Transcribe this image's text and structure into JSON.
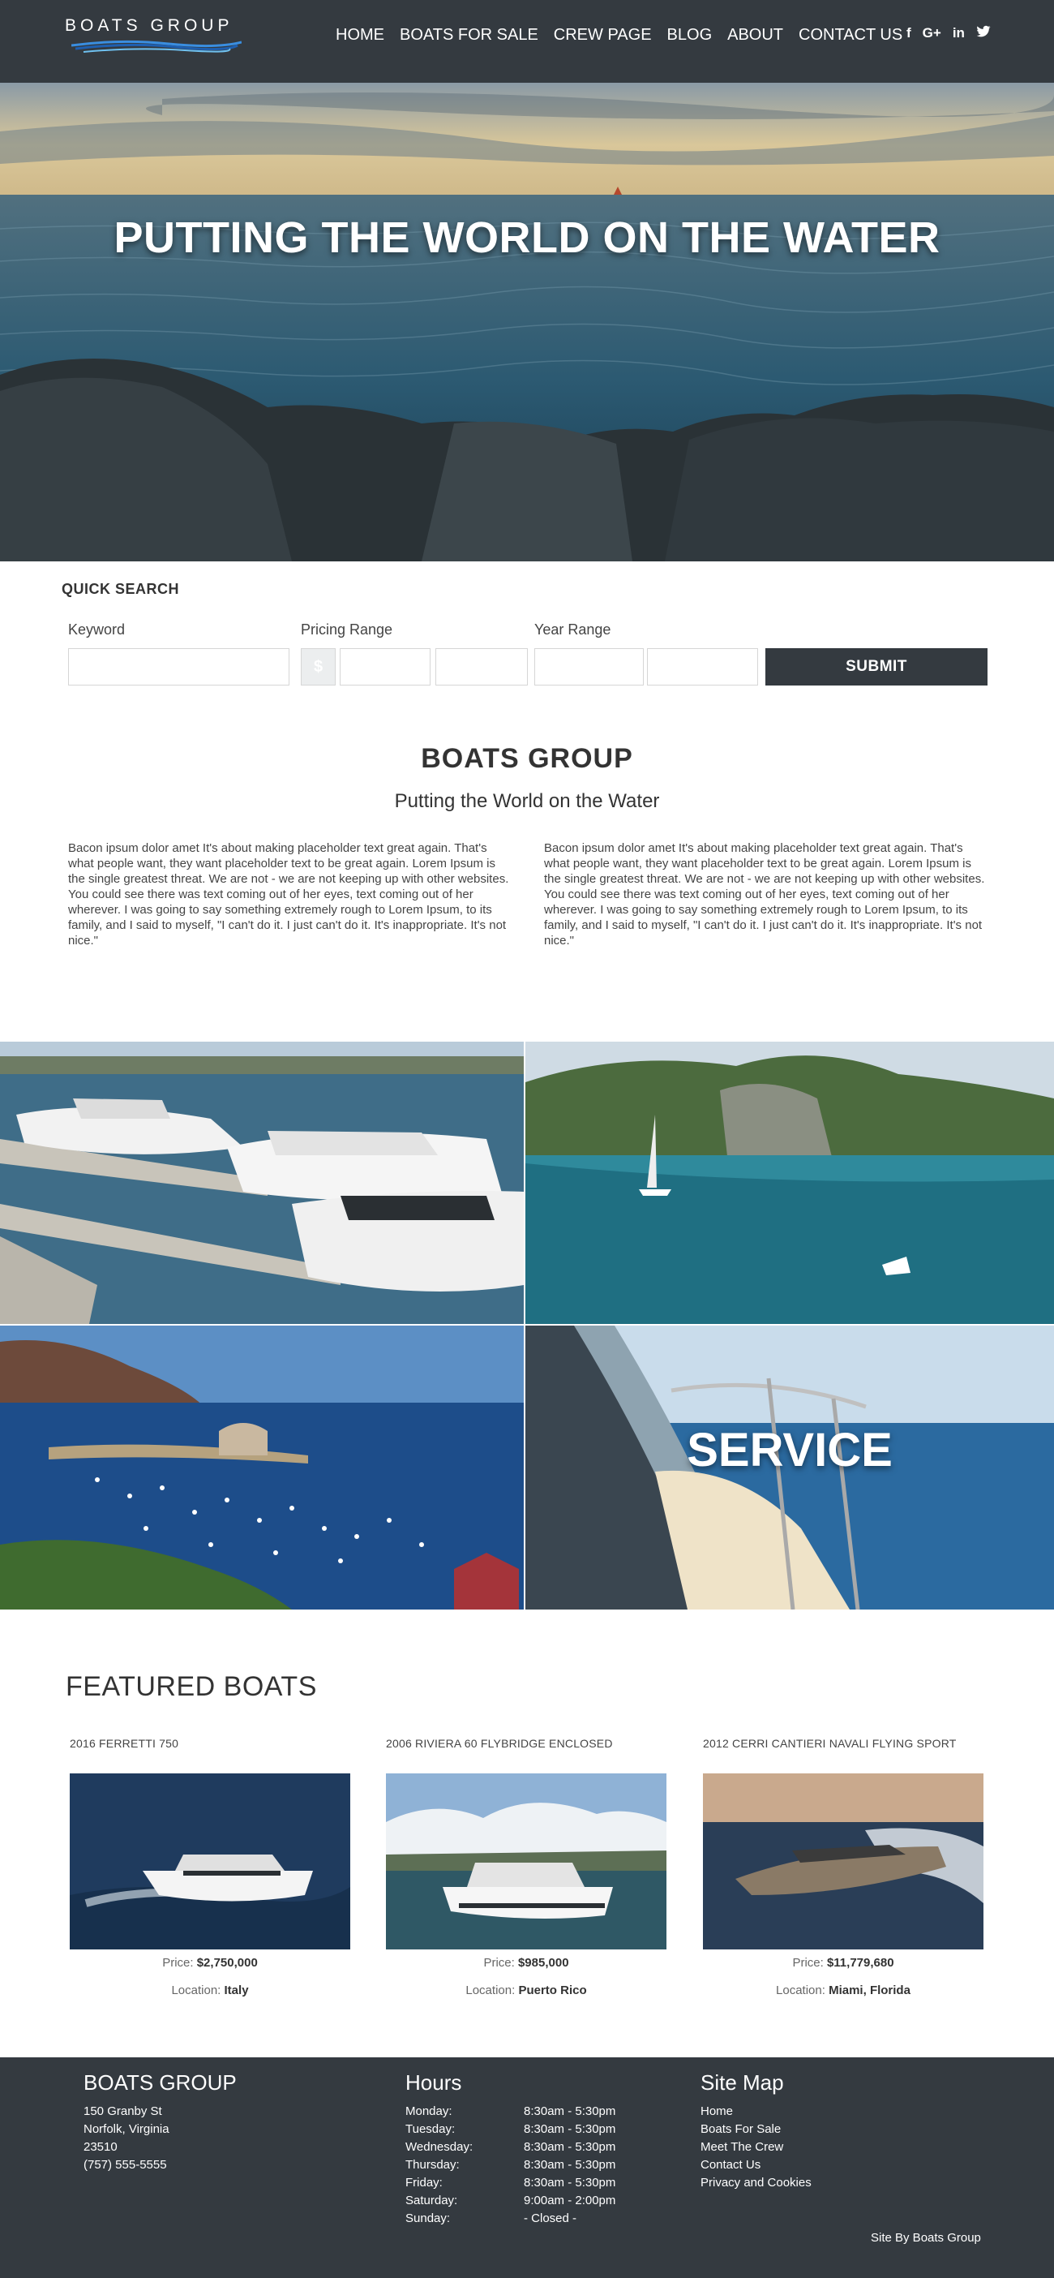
{
  "header": {
    "logo": "BOATS GROUP",
    "nav": [
      "HOME",
      "BOATS FOR SALE",
      "CREW PAGE",
      "BLOG",
      "ABOUT",
      "CONTACT US"
    ],
    "social": [
      "f",
      "G+",
      "in",
      "🐦"
    ],
    "social_icons": [
      "facebook-icon",
      "google-plus-icon",
      "linkedin-icon",
      "twitter-icon"
    ]
  },
  "hero": {
    "title": "PUTTING THE WORLD ON THE WATER"
  },
  "quick_search": {
    "title": "QUICK SEARCH",
    "keyword_label": "Keyword",
    "pricing_label": "Pricing Range",
    "year_label": "Year Range",
    "currency": "$",
    "submit": "SUBMIT"
  },
  "about": {
    "title": "BOATS GROUP",
    "subtitle": "Putting the World on the Water",
    "paragraph_left": "Bacon ipsum dolor amet It's about making placeholder text great again. That's what people want, they want placeholder text to be great again. Lorem Ipsum is the single greatest threat. We are not - we are not keeping up with other websites. You could see there was text coming out of her eyes, text coming out of her wherever. I was going to say something extremely rough to Lorem Ipsum, to its family, and I said to myself, \"I can't do it. I just can't do it. It's inappropriate. It's not nice.\"",
    "paragraph_right": "Bacon ipsum dolor amet It's about making placeholder text great again. That's what people want, they want placeholder text to be great again. Lorem Ipsum is the single greatest threat. We are not - we are not keeping up with other websites. You could see there was text coming out of her eyes, text coming out of her wherever. I was going to say something extremely rough to Lorem Ipsum, to its family, and I said to myself, \"I can't do it. I just can't do it. It's inappropriate. It's not nice.\""
  },
  "gallery": {
    "service_label": "SERVICE"
  },
  "featured": {
    "title": "FEATURED BOATS",
    "price_label": "Price:",
    "location_label": "Location:",
    "boats": [
      {
        "name": "2016 FERRETTI 750",
        "price": "$2,750,000",
        "location": "Italy"
      },
      {
        "name": "2006 RIVIERA 60 FLYBRIDGE ENCLOSED",
        "price": "$985,000",
        "location": "Puerto Rico"
      },
      {
        "name": "2012 CERRI CANTIERI NAVALI FLYING SPORT",
        "price": "$11,779,680",
        "location": "Miami, Florida"
      }
    ]
  },
  "footer": {
    "company": {
      "title": "BOATS GROUP",
      "lines": [
        "150 Granby St",
        "Norfolk, Virginia",
        "23510",
        "(757) 555-5555"
      ]
    },
    "hours": {
      "title": "Hours",
      "rows": [
        {
          "day": "Monday:",
          "time": "8:30am - 5:30pm"
        },
        {
          "day": "Tuesday:",
          "time": "8:30am - 5:30pm"
        },
        {
          "day": "Wednesday:",
          "time": "8:30am - 5:30pm"
        },
        {
          "day": "Thursday:",
          "time": "8:30am - 5:30pm"
        },
        {
          "day": "Friday:",
          "time": "8:30am - 5:30pm"
        },
        {
          "day": "Saturday:",
          "time": "9:00am - 2:00pm"
        },
        {
          "day": "Sunday:",
          "time": "- Closed -"
        }
      ]
    },
    "sitemap": {
      "title": "Site Map",
      "links": [
        "Home",
        "Boats For Sale",
        "Meet The Crew",
        "Contact Us",
        "Privacy and Cookies"
      ]
    },
    "credit": "Site By Boats Group"
  },
  "colors": {
    "dark": "#343a40",
    "accent_wave": "#2a7fd4"
  }
}
